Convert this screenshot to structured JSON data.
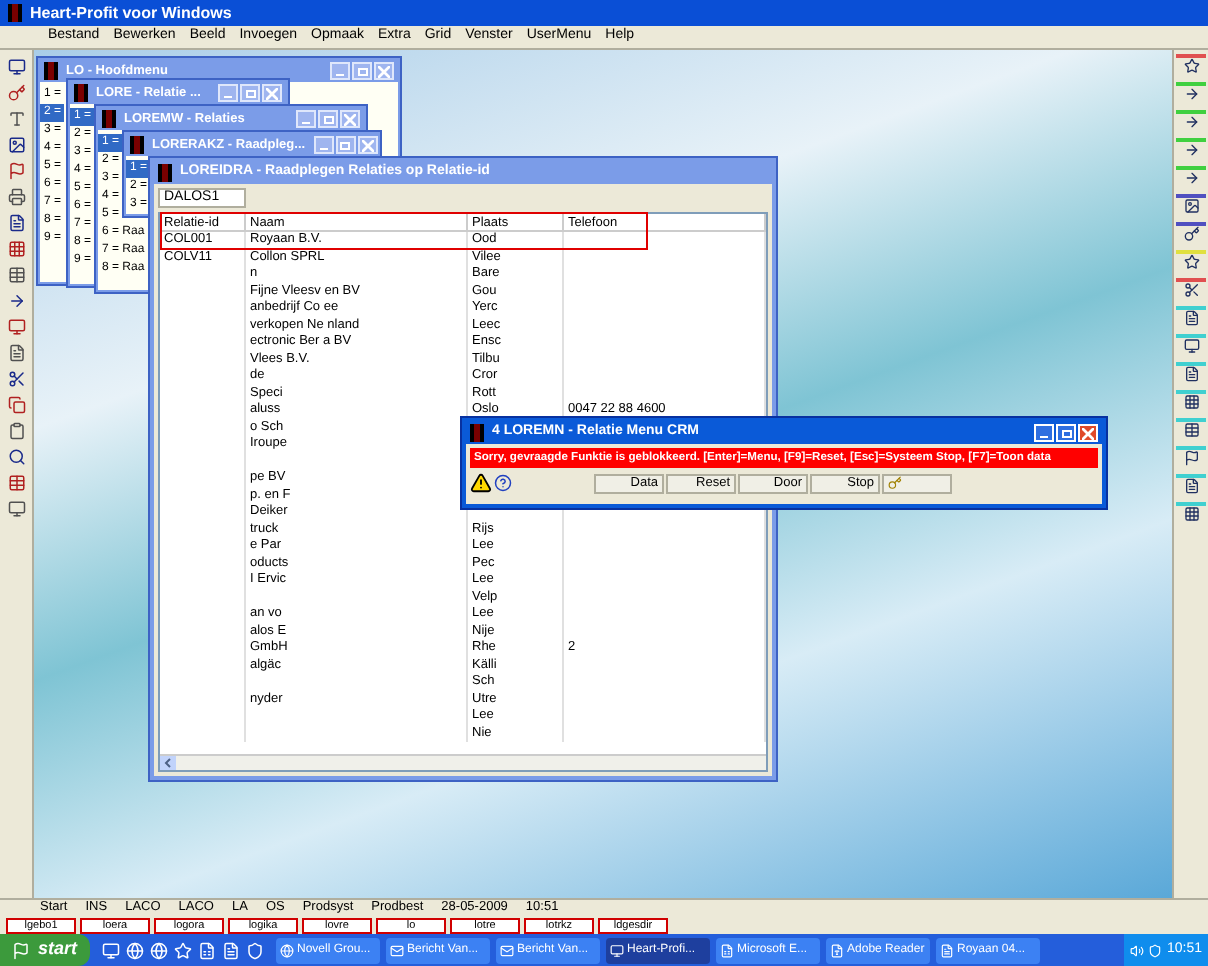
{
  "window": {
    "title": "Heart-Profit voor Windows"
  },
  "menu": [
    "Bestand",
    "Bewerken",
    "Beeld",
    "Invoegen",
    "Opmaak",
    "Extra",
    "Grid",
    "Venster",
    "UserMenu",
    "Help"
  ],
  "mdi_windows": [
    {
      "title": "LO - Hoofdmenu",
      "rows": [
        {
          "label": "1 =",
          "selected": false
        },
        {
          "label": "2 =",
          "selected": true
        },
        {
          "label": "3 =",
          "selected": false
        },
        {
          "label": "4 =",
          "selected": false
        },
        {
          "label": "5 =",
          "selected": false
        },
        {
          "label": "6 =",
          "selected": false
        },
        {
          "label": "7 =",
          "selected": false
        },
        {
          "label": "8 =",
          "selected": false
        },
        {
          "label": "9 =",
          "selected": false
        }
      ]
    },
    {
      "title": "LORE - Relatie ...",
      "rows": [
        {
          "label": "1 =",
          "selected": true
        },
        {
          "label": "2 =",
          "selected": false
        },
        {
          "label": "3 =",
          "selected": false
        },
        {
          "label": "4 =",
          "selected": false
        },
        {
          "label": "5 =",
          "selected": false
        },
        {
          "label": "6 =",
          "selected": false
        },
        {
          "label": "7 =",
          "selected": false
        },
        {
          "label": "8 =",
          "selected": false
        },
        {
          "label": "9 =",
          "selected": false
        }
      ]
    },
    {
      "title": "LOREMW - Relaties",
      "rows": [
        {
          "label": "1 =",
          "selected": true
        },
        {
          "label": "2 =",
          "selected": false
        },
        {
          "label": "3 =",
          "selected": false
        },
        {
          "label": "4 =",
          "selected": false
        },
        {
          "label": "5 =",
          "selected": false
        },
        {
          "label": "6 = Raa",
          "selected": false
        },
        {
          "label": "7 = Raa",
          "selected": false
        },
        {
          "label": "8 = Raa",
          "selected": false
        }
      ]
    },
    {
      "title": "LORERAKZ - Raadpleg...",
      "rows": [
        {
          "label": "1 =",
          "selected": true
        },
        {
          "label": "2 =",
          "selected": false
        },
        {
          "label": "3 =",
          "selected": false
        }
      ]
    }
  ],
  "main_window": {
    "title": "LOREIDRA - Raadplegen Relaties op Relatie-id",
    "search_value": "DALOS1",
    "columns": [
      "Relatie-id",
      "Naam",
      "Plaats",
      "Telefoon"
    ],
    "rows": [
      [
        "COL001",
        "Royaan B.V.",
        "Ood",
        ""
      ],
      [
        "COLV11",
        "Collon SPRL",
        "Vilee",
        ""
      ],
      [
        "",
        "n",
        "Bare",
        ""
      ],
      [
        "",
        "Fijne Vleesv   en BV",
        "Gou",
        ""
      ],
      [
        "",
        "anbedrijf Co   ee",
        "Yerc",
        ""
      ],
      [
        "",
        "verkopen Ne   nland",
        "Leec",
        ""
      ],
      [
        "",
        "ectronic Ber   a BV",
        "Ensc",
        ""
      ],
      [
        "",
        "Vlees B.V.",
        "Tilbu",
        ""
      ],
      [
        "",
        "de",
        "Cror",
        ""
      ],
      [
        "",
        "Speci",
        "Rott",
        ""
      ],
      [
        "",
        "aluss",
        "Oslo",
        "0047 22 88 4600"
      ],
      [
        "",
        "o Sch",
        "",
        ""
      ],
      [
        "",
        "Iroupe",
        "",
        ""
      ],
      [
        "",
        "",
        "",
        ""
      ],
      [
        "",
        "pe BV",
        "",
        ""
      ],
      [
        "",
        "p. en F",
        "",
        ""
      ],
      [
        "",
        "Deiker",
        "",
        ""
      ],
      [
        "",
        "truck",
        "Rijs",
        ""
      ],
      [
        "",
        "e Par",
        "Lee",
        ""
      ],
      [
        "",
        "oducts",
        "Pec",
        ""
      ],
      [
        "",
        "I Ervic",
        "Lee",
        ""
      ],
      [
        "",
        "",
        "Velp",
        ""
      ],
      [
        "",
        "an vo",
        "Lee",
        ""
      ],
      [
        "",
        "alos E",
        "Nije",
        ""
      ],
      [
        "",
        "GmbH",
        "Rhe",
        "2"
      ],
      [
        "",
        "algäc",
        "Källi",
        ""
      ],
      [
        "",
        "",
        "Sch",
        ""
      ],
      [
        "",
        "nyder",
        "Utre",
        ""
      ],
      [
        "",
        "",
        "Lee",
        ""
      ],
      [
        "",
        "",
        "Nie",
        ""
      ]
    ]
  },
  "dialog": {
    "title": "4 LOREMN - Relatie Menu CRM",
    "message": "Sorry, gevraagde Funktie is geblokkeerd.  [Enter]=Menu, [F9]=Reset, [Esc]=Systeem Stop, [F7]=Toon data",
    "buttons": [
      "Data",
      "Reset",
      "Door",
      "Stop"
    ]
  },
  "status_bar": [
    "Start",
    "INS",
    "LACO",
    "LACO",
    "LA",
    "OS",
    "Prodsyst",
    "Prodbest",
    "28-05-2009",
    "10:51"
  ],
  "function_keys": [
    "lgebo1",
    "loera",
    "logora",
    "logika",
    "lovre",
    "lo",
    "lotre",
    "lotrkz",
    "ldgesdir"
  ],
  "taskbar": {
    "start": "start",
    "tasks": [
      {
        "label": "Novell Grou...",
        "selected": false
      },
      {
        "label": "Bericht Van...",
        "selected": false
      },
      {
        "label": "Bericht Van...",
        "selected": false
      },
      {
        "label": "Heart-Profi...",
        "selected": true
      },
      {
        "label": "Microsoft E...",
        "selected": false
      },
      {
        "label": "Adobe Reader",
        "selected": false
      },
      {
        "label": "Royaan 04...",
        "selected": false
      }
    ],
    "clock": "10:51"
  }
}
